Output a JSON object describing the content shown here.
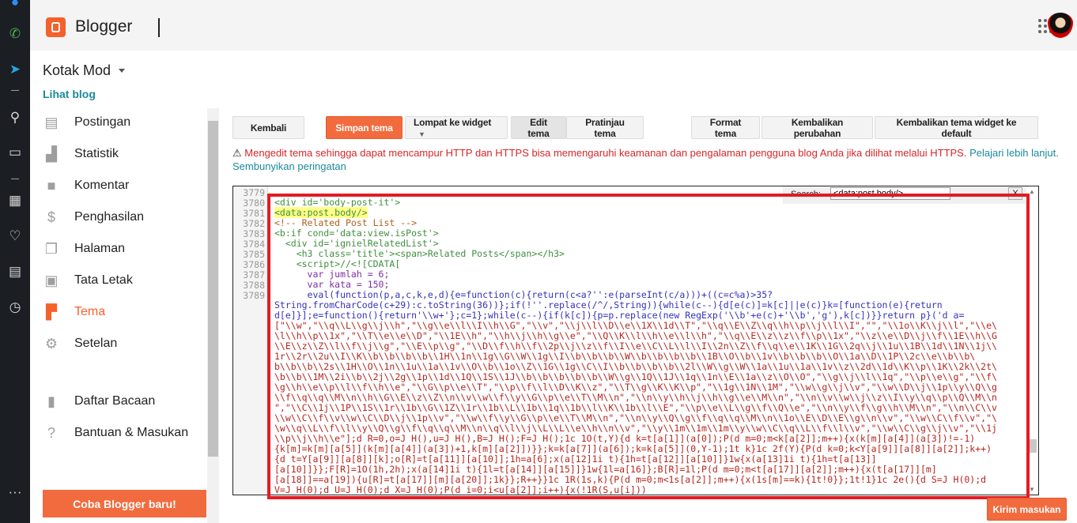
{
  "header": {
    "brand": "Blogger",
    "logo_icon": "blogger-logo-icon",
    "apps_icon": "apps-grid-icon",
    "avatar": "user-avatar"
  },
  "blog": {
    "name": "Kotak Mod",
    "view_link": "Lihat blog"
  },
  "sidebar": {
    "items": [
      {
        "label": "Postingan",
        "icon": "posts-icon"
      },
      {
        "label": "Statistik",
        "icon": "stats-icon"
      },
      {
        "label": "Komentar",
        "icon": "comment-icon"
      },
      {
        "label": "Penghasilan",
        "icon": "dollar-icon"
      },
      {
        "label": "Halaman",
        "icon": "pages-icon"
      },
      {
        "label": "Tata Letak",
        "icon": "layout-icon"
      },
      {
        "label": "Tema",
        "icon": "paint-roller-icon",
        "active": true
      },
      {
        "label": "Setelan",
        "icon": "gear-icon"
      },
      {
        "label": "Daftar Bacaan",
        "icon": "bookmark-icon"
      },
      {
        "label": "Bantuan & Masukan",
        "icon": "help-icon"
      }
    ],
    "cta": "Coba Blogger baru!"
  },
  "toolbar": {
    "back": "Kembali",
    "save": "Simpan tema",
    "jump": "Lompat ke widget",
    "edit": "Edit tema",
    "preview": "Pratinjau tema",
    "format": "Format tema",
    "revert": "Kembalikan perubahan",
    "reset_widgets": "Kembalikan tema widget ke default"
  },
  "warning": {
    "text": "Mengedit tema sehingga dapat mencampur HTTP dan HTTPS bisa memengaruhi keamanan dan pengalaman pengguna blog Anda jika dilihat melalui HTTPS.",
    "learn_more": "Pelajari lebih lanjut.",
    "hide": "Sembunyikan peringatan"
  },
  "search": {
    "label": "Search:",
    "value": "<data:post.body/>",
    "close": "X"
  },
  "editor": {
    "line_numbers": [
      "3779",
      "3780",
      "3781",
      "3782",
      "3783",
      "3784",
      "3785",
      "3786",
      "3787",
      "3788",
      "3789"
    ],
    "lines": [
      "<div id='body-post-it'>",
      "<data:post.body/>",
      "<!-- Related Post List -->",
      "<b:if cond='data:view.isPost'>",
      "  <div id='ignielRelatedList'>",
      "    <h3 class='title'><span>Related Posts</span></h3>",
      "    <script>//<![CDATA[",
      "      var jumlah = 6;",
      "      var kata = 150;",
      "      eval(function(p,a,c,k,e,d){e=function(c){return(c<a?'':e(parseInt(c/a)))+((c=c%a)>35?"
    ],
    "wrapped": [
      "String.fromCharCode(c+29):c.toString(36))};if(!''.replace(/^/,String)){while(c--){d[e(c)]=k[c]||e(c)}k=[function(e){return",
      "d[e]}];e=function(){return'\\\\w+'};c=1};while(c--){if(k[c]){p=p.replace(new RegExp('\\\\b'+e(c)+'\\\\b','g'),k[c])}}return p}('d a=",
      "[\"\\\\w\",\"\\\\q\\\\L\\\\g\\\\j\\\\h\",\"\\\\g\\\\e\\\\l\\\\I\\\\h\\\\G\",\"\\\\v\",\"\\\\j\\\\l\\\\D\\\\e\\\\1X\\\\1d\\\\T\",\"\\\\q\\\\E\\\\Z\\\\q\\\\h\\\\p\\\\j\\\\l\\\\I\",\"\",\"\\\\1o\\\\K\\\\j\\\\l\",\"\\\\e\\",
      "\\l\\\\h\\\\p\\\\1x\",\"\\\\T\\\\e\\\\e\\\\D\",\"\\\\1E\\\\h\",\"\\\\h\\\\j\\\\h\\\\g\\\\e\",\"\\\\Q\\\\K\\\\l\\\\h\\\\e\\\\l\\\\h\",\"\\\\q\\\\E\\\\z\\\\z\\\\f\\\\p\\\\1x\",\"\\\\z\\\\e\\\\D\\\\j\\\\f\\\\1E\\\\h\\\\G",
      "\\\\E\\\\z\\\\Z\\\\l\\\\f\\\\j\\\\g\",\"\\\\E\\\\p\\\\g\",\"\\\\D\\\\f\\\\h\\\\f\\\\2p\\\\j\\\\z\\\\f\\\\I\\\\e\\\\C\\\\L\\\\l\\\\I\\\\2n\\\\Z\\\\f\\\\q\\\\e\\\\1K\\\\1G\\\\2q\\\\j\\\\1u\\\\1B\\\\1d\\\\1N\\\\1j\\\\",
      "1r\\\\2r\\\\2u\\\\I\\\\K\\\\b\\\\b\\\\b\\\\b\\\\1H\\\\1n\\\\1g\\\\G\\\\W\\\\1g\\\\I\\\\b\\\\b\\\\b\\\\W\\\\b\\\\b\\\\b\\\\b\\\\1B\\\\O\\\\b\\\\1v\\\\b\\\\b\\\\b\\\\O\\\\1a\\\\D\\\\1P\\\\2c\\\\e\\\\b\\\\b\\",
      "b\\\\b\\\\b\\\\2s\\\\1H\\\\O\\\\1n\\\\1u\\\\1a\\\\1v\\\\O\\\\b\\\\1o\\\\Z\\\\1G\\\\1g\\\\C\\\\I\\\\b\\\\b\\\\b\\\\b\\\\2l\\\\W\\\\g\\\\W\\\\1a\\\\1u\\\\1a\\\\1v\\\\z\\\\2d\\\\1d\\\\K\\\\p\\\\1K\\\\2k\\\\2t\\",
      "\\b\\\\b\\\\1M\\\\2i\\\\b\\\\2j\\\\2g\\\\1p\\\\1d\\\\1Q\\\\1S\\\\1J\\\\b\\\\b\\\\b\\\\b\\\\b\\\\W\\\\g\\\\1Q\\\\1J\\\\1q\\\\1n\\\\E\\\\1a\\\\z\\\\O\\\\O\",\"\\\\g\\\\j\\\\l\\\\1q\",\"\\\\p\\\\e\\\\g\",\"\\\\f\\",
      "\\g\\\\h\\\\e\\\\p\\\\l\\\\f\\\\h\\\\e\",\"\\\\G\\\\p\\\\e\\\\T\",\"\\\\p\\\\f\\\\l\\\\D\\\\K\\\\z\",\"\\\\T\\\\g\\\\K\\\\K\\\\p\",\"\\\\1g\\\\1N\\\\1M\",\"\\\\w\\\\g\\\\j\\\\v\",\"\\\\w\\\\D\\\\j\\\\1p\\\\y\\\\Q\\\\g",
      "\\\\f\\\\q\\\\q\\\\M\\\\n\\\\h\\\\G\\\\E\\\\z\\\\Z\\\\n\\\\v\\\\w\\\\f\\\\y\\\\G\\\\p\\\\e\\\\T\\\\M\\\\n\",\"\\\\n\\\\y\\\\h\\\\j\\\\h\\\\g\\\\e\\\\M\\\\n\",\"\\\\n\\\\v\\\\w\\\\j\\\\z\\\\I\\\\y\\\\q\\\\p\\\\Q\\\\M\\\\n",
      "\",\"\\\\C\\\\1j\\\\1P\\\\1S\\\\1r\\\\1b\\\\G\\\\1Z\\\\1r\\\\1b\\\\L\\\\1b\\\\1q\\\\1b\\\\l\\\\K\\\\1b\\\\l\\\\E\",\"\\\\p\\\\e\\\\L\\\\g\\\\f\\\\Q\\\\e\",\"\\\\n\\\\y\\\\f\\\\g\\\\h\\\\M\\\\n\",\"\\\\n\\\\C\\\\v",
      "\\\\w\\\\C\\\\f\\\\v\\\\w\\\\C\\\\D\\\\j\\\\1p\\\\v\",\"\\\\w\\\\f\\\\y\\\\G\\\\p\\\\e\\\\T\\\\M\\\\n\",\"\\\\n\\\\y\\\\Q\\\\g\\\\f\\\\q\\\\q\\\\M\\\\n\\\\1o\\\\E\\\\D\\\\E\\\\g\\\\n\\\\v\",\"\\\\w\\\\C\\\\f\\\\v\",\"\\",
      "\\w\\\\q\\\\L\\\\f\\\\l\\\\y\\\\Q\\\\g\\\\f\\\\q\\\\q\\\\M\\\\n\\\\q\\\\l\\\\j\\\\L\\\\L\\\\e\\\\h\\\\n\\\\v\",\"\\\\y\\\\1m\\\\1m\\\\1m\\\\y\\\\w\\\\C\\\\q\\\\L\\\\f\\\\l\\\\v\",\"\\\\w\\\\C\\\\g\\\\j\\\\v\",\"\\\\1j",
      "\\\\p\\\\j\\\\h\\\\e\"];d R=0,o=J H(),u=J H(),B=J H();F=J H();1c 1O(t,Y){d k=t[a[1]](a[0]);P(d m=0;m<k[a[2]];m++){x(k[m][a[4]](a[3])!=-1)",
      "{k[m]=k[m][a[5]](k[m][a[4]](a[3])+1,k[m][a[2]])}};k=k[a[7]](a[6]);k=k[a[5]](0,Y-1);1t k}1c 2f(Y){P(d k=0;k<Y[a[9]][a[8]][a[2]];k++)",
      "{d t=Y[a[9]][a[8]][k];o[R]=t[a[11]][a[10]];1h=a[6];x(a[12]1i t){1h=t[a[12]][a[10]]}1w{x(a[13]1i t){1h=t[a[13]]",
      "[a[10]]}};F[R]=1O(1h,2h);x(a[14]1i t){1l=t[a[14]][a[15]]}1w{1l=a[16]};B[R]=1l;P(d m=0;m<t[a[17]][a[2]];m++){x(t[a[17]][m]",
      "[a[18]]==a[19]){u[R]=t[a[17]][m][a[20]];1k}};R++}}1c 1R(1s,k){P(d m=0;m<1s[a[2]];m++){x(1s[m]==k){1t!0}};1t!1}1c 2e(){d S=J H(0);d",
      "V=J H(0);d U=J H(0);d X=J H(0);P(d i=0;i<u[a[2]];i++){x(!1R(S,u[i]))"
    ]
  },
  "feedback": "Kirim masukan",
  "colors": {
    "accent": "#f26b3e",
    "highlight_box": "#e41b23",
    "link": "#1a8a9c",
    "warning": "#d6262a"
  }
}
